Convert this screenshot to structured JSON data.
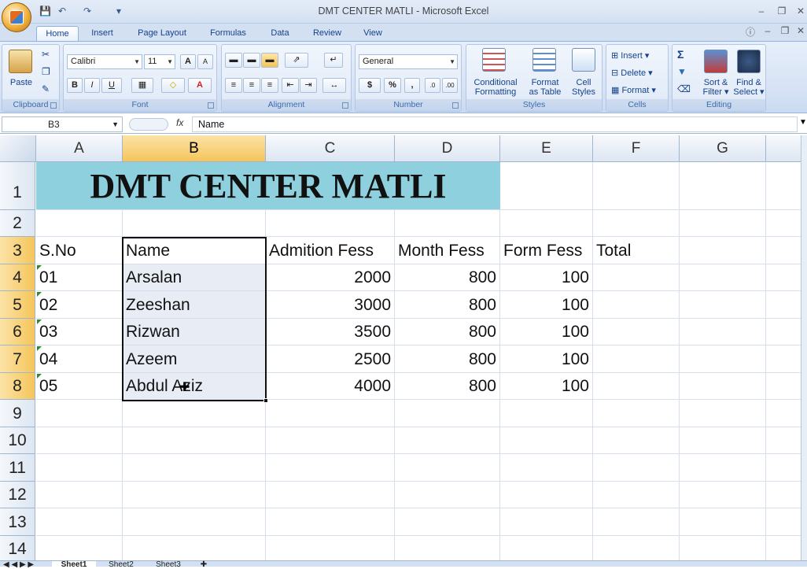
{
  "window": {
    "title": "DMT CENTER MATLI - Microsoft Excel"
  },
  "tabs": [
    "Home",
    "Insert",
    "Page Layout",
    "Formulas",
    "Data",
    "Review",
    "View"
  ],
  "ribbon": {
    "clipboard": {
      "label": "Clipboard",
      "paste": "Paste"
    },
    "font": {
      "label": "Font",
      "name": "Calibri",
      "size": "11",
      "bold": "B",
      "italic": "I",
      "underline": "U",
      "grow": "A",
      "shrink": "A"
    },
    "alignment": {
      "label": "Alignment"
    },
    "number": {
      "label": "Number",
      "format": "General",
      "currency": "$",
      "percent": "%",
      "comma": ","
    },
    "styles": {
      "label": "Styles",
      "conditional": "Conditional",
      "conditional2": "Formatting",
      "format_table": "Format",
      "format_table2": "as Table",
      "cell_styles": "Cell",
      "cell_styles2": "Styles"
    },
    "cells": {
      "label": "Cells",
      "insert": "Insert",
      "delete": "Delete",
      "format": "Format"
    },
    "editing": {
      "label": "Editing",
      "sort": "Sort &",
      "sort2": "Filter",
      "find": "Find &",
      "find2": "Select"
    }
  },
  "formula_bar": {
    "name_box": "B3",
    "fx": "fx",
    "content": "Name"
  },
  "columns": [
    "A",
    "B",
    "C",
    "D",
    "E",
    "F",
    "G"
  ],
  "rows": [
    "1",
    "2",
    "3",
    "4",
    "5",
    "6",
    "7",
    "8",
    "9",
    "10",
    "11",
    "12",
    "13",
    "14"
  ],
  "sheet": {
    "title": "DMT CENTER MATLI",
    "headers": [
      "S.No",
      "Name",
      "Admition Fess",
      "Month Fess",
      "Form Fess",
      "Total"
    ],
    "data": [
      [
        "01",
        "Arsalan",
        "2000",
        "800",
        "100"
      ],
      [
        "02",
        "Zeeshan",
        "3000",
        "800",
        "100"
      ],
      [
        "03",
        "Rizwan",
        "3500",
        "800",
        "100"
      ],
      [
        "04",
        "Azeem",
        "2500",
        "800",
        "100"
      ],
      [
        "05",
        "Abdul Aziz",
        "4000",
        "800",
        "100"
      ]
    ]
  },
  "sheet_tabs": [
    "Sheet1",
    "Sheet2",
    "Sheet3"
  ],
  "colors": {
    "title_fill": "#8fd0de",
    "selected_header": "#f5c55b",
    "ribbon": "#d5e2f4"
  }
}
